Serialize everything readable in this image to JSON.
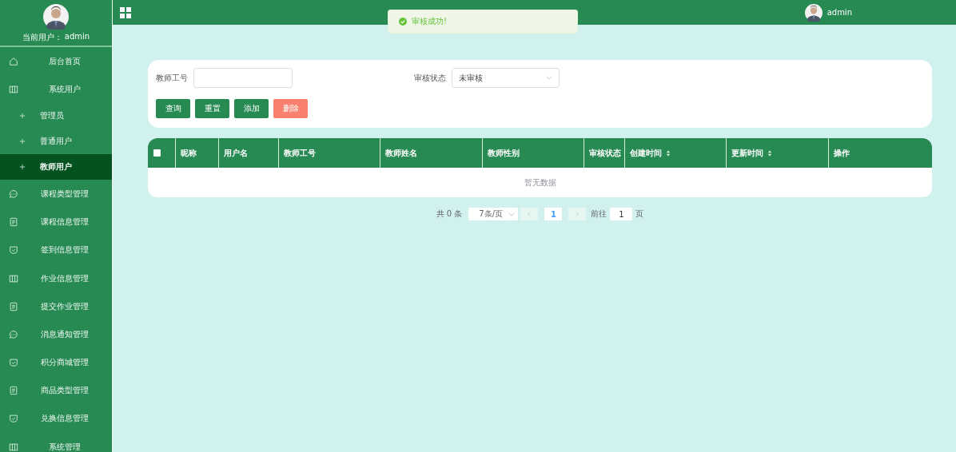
{
  "sidebar": {
    "current_user_label": "当前用户：",
    "current_user": "admin",
    "items": [
      {
        "label": "后台首页",
        "kind": "home",
        "selected": false
      },
      {
        "label": "系统用户",
        "kind": "columns",
        "selected": false,
        "children": [
          {
            "label": "管理员",
            "selected": false
          },
          {
            "label": "普通用户",
            "selected": false
          },
          {
            "label": "教师用户",
            "selected": true
          }
        ]
      },
      {
        "label": "课程类型管理",
        "kind": "chat",
        "selected": false
      },
      {
        "label": "课程信息管理",
        "kind": "doc",
        "selected": false
      },
      {
        "label": "签到信息管理",
        "kind": "shield",
        "selected": false
      },
      {
        "label": "作业信息管理",
        "kind": "columns",
        "selected": false
      },
      {
        "label": "提交作业管理",
        "kind": "doc",
        "selected": false
      },
      {
        "label": "消息通知管理",
        "kind": "chat",
        "selected": false
      },
      {
        "label": "积分商城管理",
        "kind": "shield",
        "selected": false
      },
      {
        "label": "商品类型管理",
        "kind": "doc",
        "selected": false
      },
      {
        "label": "兑换信息管理",
        "kind": "shield",
        "selected": false
      },
      {
        "label": "系统管理",
        "kind": "columns",
        "selected": false
      }
    ]
  },
  "header": {
    "user": "admin"
  },
  "toast": {
    "message": "审核成功!"
  },
  "search": {
    "fields": [
      {
        "kind": "input",
        "label": "教师工号"
      },
      {
        "kind": "select",
        "label": "审核状态",
        "value": "未审核"
      }
    ],
    "buttons": [
      {
        "label": "查询",
        "kind": "primary"
      },
      {
        "label": "重置",
        "kind": "primary"
      },
      {
        "label": "添加",
        "kind": "primary"
      },
      {
        "label": "删除",
        "kind": "danger"
      }
    ]
  },
  "table": {
    "select_all": {
      "checked": false
    },
    "columns": [
      {
        "label": "昵称",
        "sortable": false
      },
      {
        "label": "用户名",
        "sortable": false
      },
      {
        "label": "教师工号",
        "sortable": false
      },
      {
        "label": "教师姓名",
        "sortable": false
      },
      {
        "label": "教师性别",
        "sortable": false
      },
      {
        "label": "审核状态",
        "sortable": false
      },
      {
        "label": "创建时间",
        "sortable": true
      },
      {
        "label": "更新时间",
        "sortable": true
      },
      {
        "label": "操作",
        "sortable": false
      }
    ],
    "empty_text": "暂无数据"
  },
  "pagination": {
    "total": "共 0 条",
    "page_size": "7条/页",
    "pages": [
      {
        "label": "1",
        "selected": true
      }
    ],
    "goto_label": "前往",
    "goto_value": "1",
    "goto_suffix": "页"
  }
}
